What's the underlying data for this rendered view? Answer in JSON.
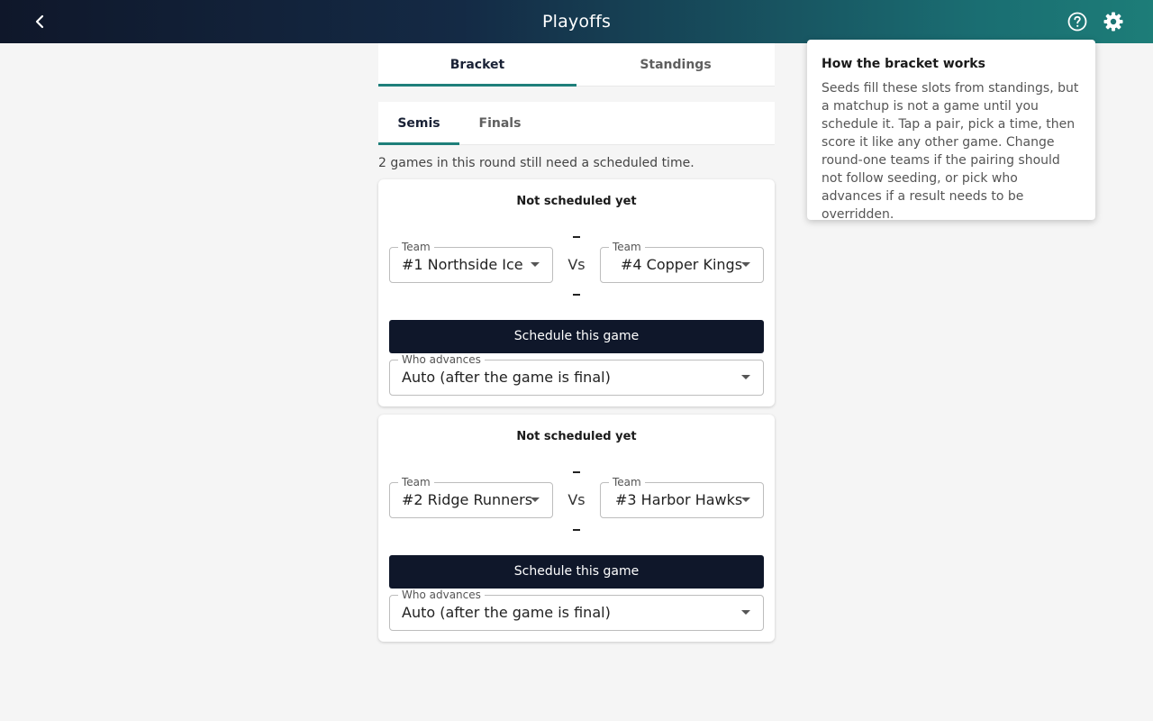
{
  "header": {
    "title": "Playoffs"
  },
  "tabs": [
    {
      "label": "Bracket",
      "active": true
    },
    {
      "label": "Standings",
      "active": false
    }
  ],
  "subtabs": [
    {
      "label": "Semis",
      "active": true
    },
    {
      "label": "Finals",
      "active": false
    }
  ],
  "round_note": "2 games in this round still need a scheduled time.",
  "matchups": [
    {
      "status": "Not scheduled yet",
      "team_label": "Team",
      "left_team": "#1 Northside Ice",
      "right_team": "#4 Copper Kings",
      "vs": "Vs",
      "schedule_label": "Schedule this game",
      "advance_label": "Who advances",
      "advance_value": "Auto (after the game is final)"
    },
    {
      "status": "Not scheduled yet",
      "team_label": "Team",
      "left_team": "#2 Ridge Runners",
      "right_team": "#3 Harbor Hawks",
      "vs": "Vs",
      "schedule_label": "Schedule this game",
      "advance_label": "Who advances",
      "advance_value": "Auto (after the game is final)"
    }
  ],
  "help_popover": {
    "title": "How the bracket works",
    "body": "Seeds fill these slots from standings, but a matchup is not a game until you schedule it. Tap a pair, pick a time, then score it like any other game. Change round-one teams if the pairing should not follow seeding, or pick who advances if a result needs to be overridden."
  },
  "icons": {
    "back": "chevron-left-icon",
    "help": "help-circle-icon",
    "settings": "gear-icon"
  },
  "colors": {
    "accent": "#1e7f7a",
    "primary_button": "#0f172a"
  }
}
